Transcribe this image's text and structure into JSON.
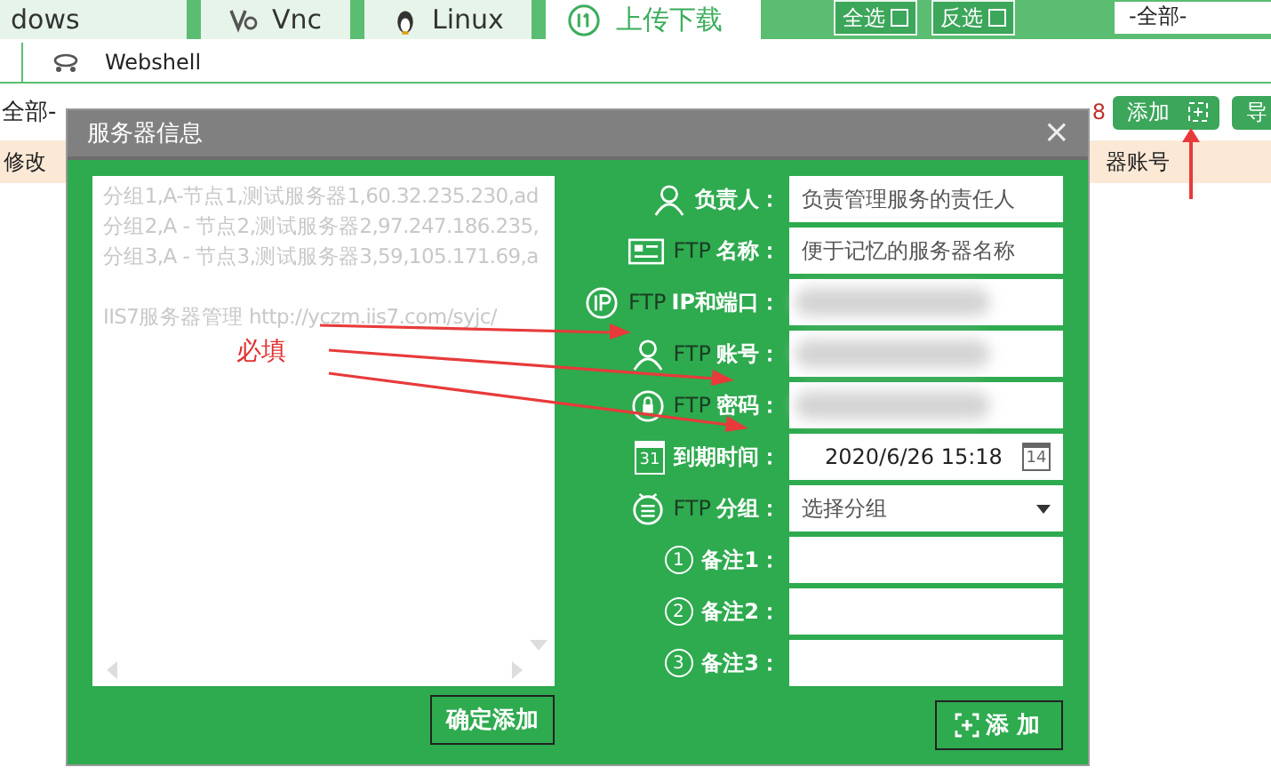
{
  "tabs": [
    {
      "label": "dows",
      "selected": false
    },
    {
      "label": "Vnc",
      "selected": false
    },
    {
      "label": "Linux",
      "selected": false
    },
    {
      "label": "上传下载",
      "selected": true
    }
  ],
  "top_buttons": [
    "全选",
    "反选"
  ],
  "group_filter": {
    "value": "-全部-"
  },
  "subtab": {
    "label": "Webshell"
  },
  "toolbar": {
    "filter_text": "全部-",
    "count": "8",
    "add_button": "添加",
    "next_button": "导"
  },
  "table_header": {
    "left": "修改",
    "right": "器账号"
  },
  "dialog": {
    "title": "服务器信息",
    "close": "×",
    "import_lines": [
      "分组1,A-节点1,测试服务器1,60.32.235.230,ad",
      "分组2,A - 节点2,测试服务器2,97.247.186.235,",
      "分组3,A - 节点3,测试服务器3,59,105.171.69,a"
    ],
    "link_line": "IIS7服务器管理 http://yczm.iis7.com/syjc/",
    "confirm_button": "确定添加",
    "fields": [
      {
        "label": "负责人：",
        "kind": "text",
        "placeholder": "负责管理服务的责任人"
      },
      {
        "prefix": "FTP",
        "label": "名称：",
        "kind": "text",
        "placeholder": "便于记忆的服务器名称"
      },
      {
        "prefix": "FTP",
        "label": "IP和端口：",
        "kind": "blurred"
      },
      {
        "prefix": "FTP",
        "label": "账号：",
        "kind": "blurred"
      },
      {
        "prefix": "FTP",
        "label": "密码：",
        "kind": "blurred"
      },
      {
        "icon_text": "31",
        "label": "到期时间：",
        "kind": "date",
        "value": "2020/6/26 15:18",
        "picker_text": "14"
      },
      {
        "prefix": "FTP",
        "label": "分组：",
        "kind": "select",
        "value": "选择分组"
      },
      {
        "icon_text": "1",
        "label": "备注1：",
        "kind": "text"
      },
      {
        "icon_text": "2",
        "label": "备注2：",
        "kind": "text"
      },
      {
        "icon_text": "3",
        "label": "备注3：",
        "kind": "text"
      }
    ],
    "add_button": "添 加"
  },
  "annotation": {
    "text": "必填"
  }
}
